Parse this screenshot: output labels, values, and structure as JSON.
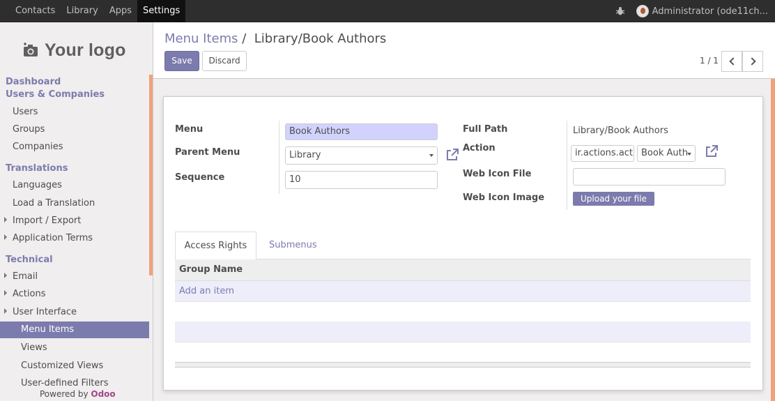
{
  "topbar": {
    "menu": [
      "Contacts",
      "Library",
      "Apps",
      "Settings"
    ],
    "active_menu": "Settings",
    "user": "Administrator (ode11ch..."
  },
  "sidebar": {
    "logo_text": "Your logo",
    "sections": [
      {
        "title": "Dashboard"
      },
      {
        "title": "Users & Companies",
        "items": [
          "Users",
          "Groups",
          "Companies"
        ]
      },
      {
        "title": "Translations",
        "items": [
          "Languages",
          "Load a Translation",
          "Import / Export",
          "Application Terms"
        ]
      },
      {
        "title": "Technical",
        "items": [
          "Email",
          "Actions",
          "User Interface",
          "Menu Items",
          "Views",
          "Customized Views",
          "User-defined Filters"
        ]
      }
    ],
    "active_item": "Menu Items",
    "powered_prefix": "Powered by",
    "powered_brand": "Odoo"
  },
  "control_panel": {
    "breadcrumb_parent": "Menu Items",
    "breadcrumb_sep": "/",
    "breadcrumb_current": "Library/Book Authors",
    "save_label": "Save",
    "discard_label": "Discard",
    "pager": "1 / 1"
  },
  "form": {
    "menu_label": "Menu",
    "menu_value": "Book Authors",
    "parent_menu_label": "Parent Menu",
    "parent_menu_value": "Library",
    "sequence_label": "Sequence",
    "sequence_value": "10",
    "full_path_label": "Full Path",
    "full_path_value": "Library/Book Authors",
    "action_label": "Action",
    "action_model_value": "ir.actions.act",
    "action_record_value": "Book Auth",
    "web_icon_file_label": "Web Icon File",
    "web_icon_file_value": "",
    "web_icon_image_label": "Web Icon Image",
    "upload_label": "Upload your file"
  },
  "tabs": [
    "Access Rights",
    "Submenus"
  ],
  "table": {
    "header": "Group Name",
    "add_item": "Add an item"
  },
  "colors": {
    "accent": "#7c7bad",
    "scroll": "#f0a27a",
    "brand": "#a24689"
  }
}
